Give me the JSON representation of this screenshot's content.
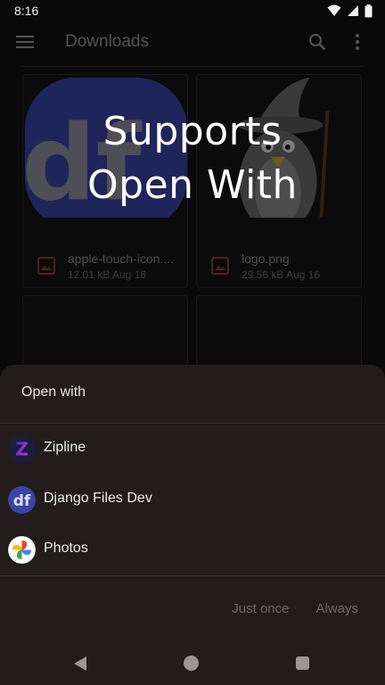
{
  "status_bar": {
    "time": "8:16"
  },
  "app_bar": {
    "title": "Downloads"
  },
  "files": [
    {
      "name": "apple-touch-icon....",
      "meta": "12.01 kB Aug 16",
      "thumb_text": "df"
    },
    {
      "name": "logo.png",
      "meta": "29.56 kB Aug 16"
    }
  ],
  "overlay": {
    "line1": "Supports",
    "line2": "Open With"
  },
  "sheet": {
    "title": "Open with",
    "apps": [
      {
        "label": "Zipline",
        "icon_text": "Z"
      },
      {
        "label": "Django Files Dev",
        "icon_text": "df"
      },
      {
        "label": "Photos"
      }
    ],
    "just_once": "Just once",
    "always": "Always"
  },
  "colors": {
    "background": "#111111",
    "sheet": "#221c1c",
    "df_blue": "#3a44a6",
    "zipline_gradient_start": "#3b2ad8",
    "zipline_gradient_end": "#d63ad0"
  }
}
